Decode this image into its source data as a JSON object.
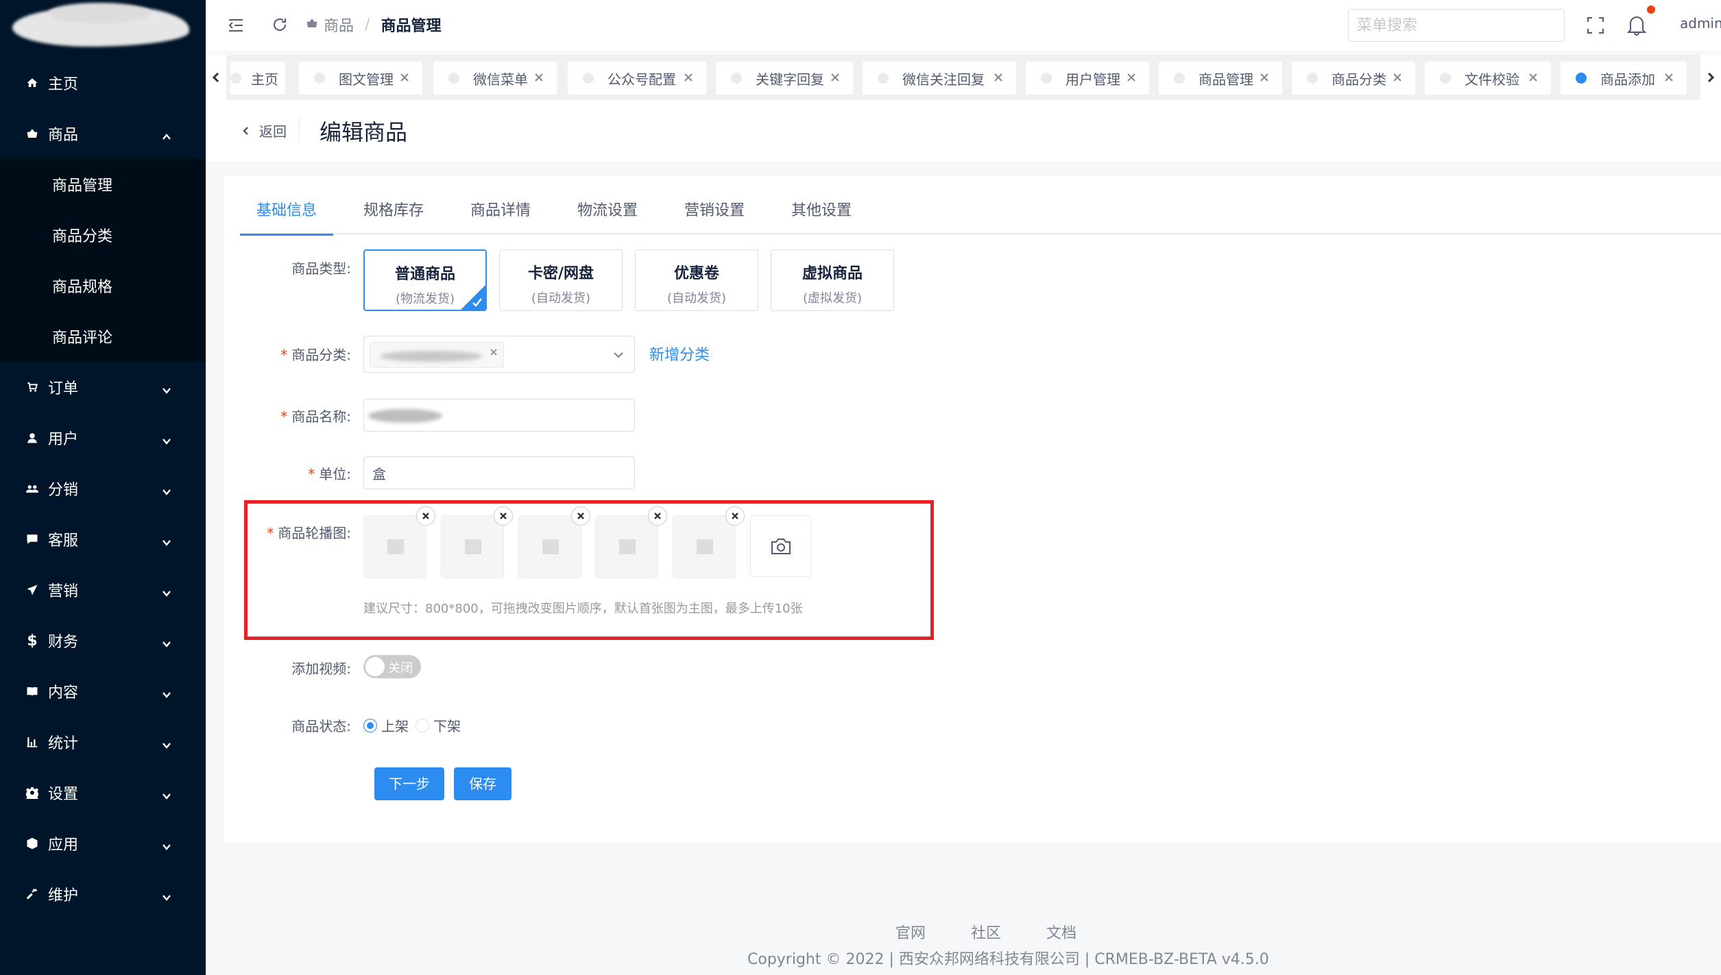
{
  "sidebar": {
    "menu": [
      {
        "label": "主页",
        "icon": "home-icon"
      },
      {
        "label": "商品",
        "icon": "basket-icon",
        "expanded": true,
        "children": [
          {
            "label": "商品管理"
          },
          {
            "label": "商品分类"
          },
          {
            "label": "商品规格"
          },
          {
            "label": "商品评论"
          }
        ]
      },
      {
        "label": "订单",
        "icon": "cart-icon"
      },
      {
        "label": "用户",
        "icon": "user-icon"
      },
      {
        "label": "分销",
        "icon": "team-icon"
      },
      {
        "label": "客服",
        "icon": "chat-icon"
      },
      {
        "label": "营销",
        "icon": "send-icon"
      },
      {
        "label": "财务",
        "icon": "dollar-icon"
      },
      {
        "label": "内容",
        "icon": "book-icon"
      },
      {
        "label": "统计",
        "icon": "bar-chart-icon"
      },
      {
        "label": "设置",
        "icon": "gear-icon"
      },
      {
        "label": "应用",
        "icon": "cube-icon"
      },
      {
        "label": "维护",
        "icon": "hammer-icon"
      }
    ]
  },
  "header": {
    "breadcrumb": [
      "商品",
      "商品管理"
    ],
    "search_placeholder": "菜单搜索",
    "user": "admin"
  },
  "tabs": [
    {
      "label": "主页",
      "closable": false,
      "active": false
    },
    {
      "label": "图文管理",
      "closable": true,
      "active": false
    },
    {
      "label": "微信菜单",
      "closable": true,
      "active": false
    },
    {
      "label": "公众号配置",
      "closable": true,
      "active": false
    },
    {
      "label": "关键字回复",
      "closable": true,
      "active": false
    },
    {
      "label": "微信关注回复",
      "closable": true,
      "active": false
    },
    {
      "label": "用户管理",
      "closable": true,
      "active": false
    },
    {
      "label": "商品管理",
      "closable": true,
      "active": false
    },
    {
      "label": "商品分类",
      "closable": true,
      "active": false
    },
    {
      "label": "文件校验",
      "closable": true,
      "active": false
    },
    {
      "label": "商品添加",
      "closable": true,
      "active": true
    }
  ],
  "page": {
    "back_label": "返回",
    "title": "编辑商品"
  },
  "form": {
    "content_tabs": [
      "基础信息",
      "规格库存",
      "商品详情",
      "物流设置",
      "营销设置",
      "其他设置"
    ],
    "active_tab": 0,
    "labels": {
      "product_type": "商品类型:",
      "category": "商品分类:",
      "name": "商品名称:",
      "unit": "单位:",
      "carousel": "商品轮播图:",
      "video": "添加视频:",
      "status": "商品状态:"
    },
    "required_mark": "*",
    "product_types": [
      {
        "name": "普通商品",
        "sub": "(物流发货)",
        "selected": true
      },
      {
        "name": "卡密/网盘",
        "sub": "(自动发货)",
        "selected": false
      },
      {
        "name": "优惠卷",
        "sub": "(自动发货)",
        "selected": false
      },
      {
        "name": "虚拟商品",
        "sub": "(虚拟发货)",
        "selected": false
      }
    ],
    "add_category": "新增分类",
    "unit_value": "盒",
    "carousel_image_count": 5,
    "carousel_tip": "建议尺寸：800*800，可拖拽改变图片顺序，默认首张图为主图，最多上传10张",
    "video_switch": {
      "label": "关闭",
      "on": false
    },
    "status_options": [
      {
        "label": "上架",
        "checked": true
      },
      {
        "label": "下架",
        "checked": false
      }
    ],
    "buttons": {
      "next": "下一步",
      "save": "保存"
    }
  },
  "footer": {
    "links": [
      "官网",
      "社区",
      "文档"
    ],
    "copyright": "Copyright © 2022 | 西安众邦网络科技有限公司 | CRMEB-BZ-BETA v4.5.0"
  },
  "colors": {
    "sidebar_bg": "#001529",
    "submenu_bg": "#000c17",
    "primary": "#2d8cf0",
    "highlight_box": "#e6212a"
  }
}
